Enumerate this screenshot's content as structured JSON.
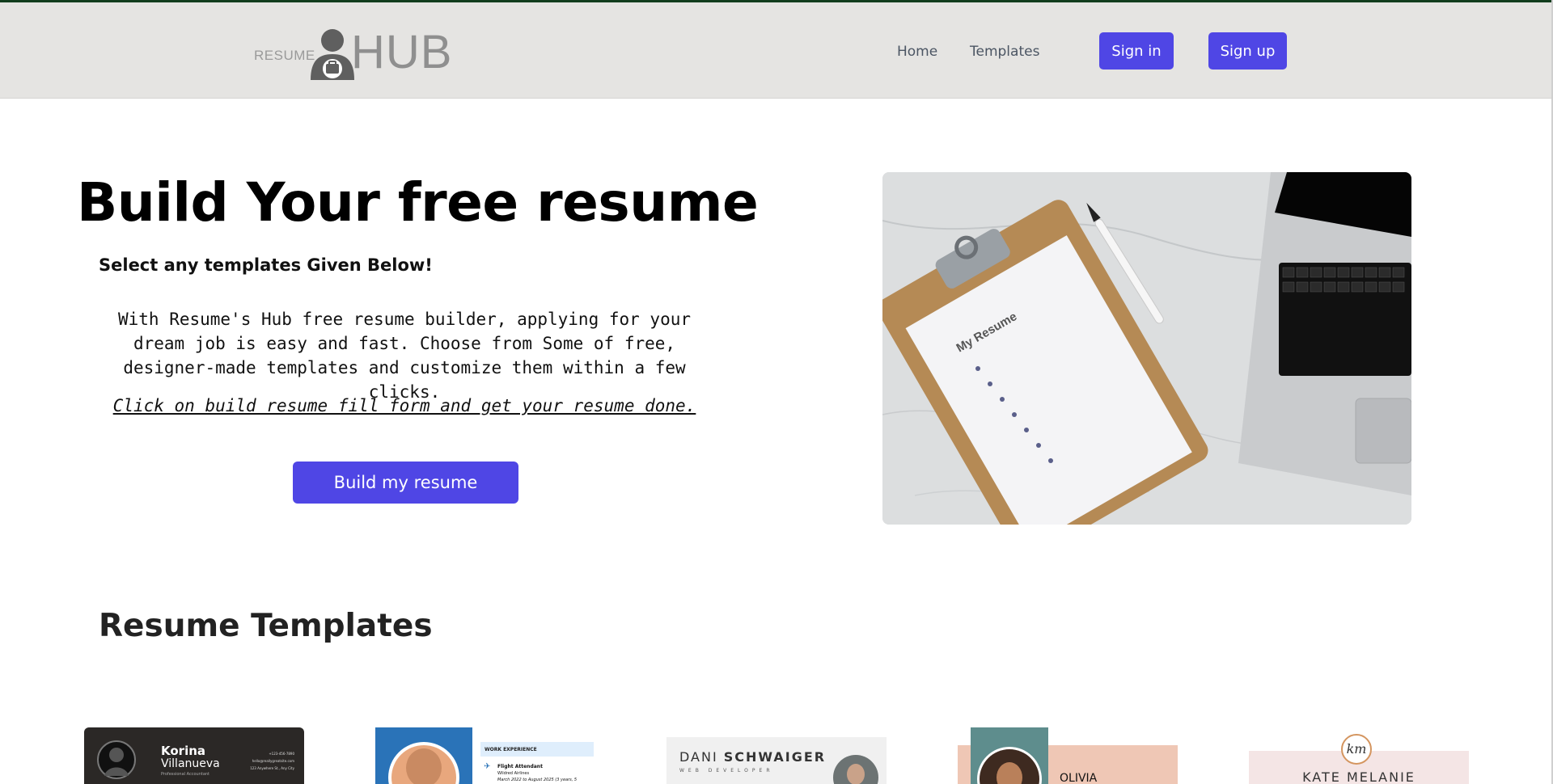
{
  "header": {
    "logo": {
      "small": "RESUME",
      "big": "HUB"
    },
    "nav": [
      "Home",
      "Templates"
    ],
    "sign_in": "Sign in",
    "sign_up": "Sign up"
  },
  "hero": {
    "title": "Build Your free resume",
    "subtitle": "Select any templates Given Below!",
    "text": "With Resume's Hub free resume builder, applying for your dream job is easy and fast. Choose from Some of free, designer-made templates and customize them within a few clicks.",
    "note": "Click on build resume fill form and get your resume done.",
    "button": "Build my resume",
    "image_caption": "My Resume"
  },
  "templates": {
    "title": "Resume Templates",
    "items": [
      {
        "first": "Korina",
        "last": "Villanueva",
        "role": "Professional Accountant",
        "contact": [
          "+123-456-7890",
          "hello@reallygreatsite.com",
          "123 Anywhere St., Any City"
        ],
        "bg": "#2b2826"
      },
      {
        "section": "WORK EXPERIENCE",
        "job": "Flight Attendant",
        "company": "Wildred Airlines",
        "dates": "March 2022 to August 2025 (3 years, 5",
        "bg": "#2a73b8"
      },
      {
        "first": "DANI",
        "last": "SCHWAIGER",
        "role": "WEB DEVELOPER",
        "bg": "#f0f0f0"
      },
      {
        "name": "OLIVIA",
        "bg": "#efc7b5",
        "accent": "#5e8d8d"
      },
      {
        "monogram": "km",
        "name": "KATE MELANIE",
        "bg": "#f4e5e5"
      }
    ]
  },
  "colors": {
    "accent": "#4f46e5",
    "header_bg": "#e5e4e2",
    "header_top_border": "#123d1d"
  }
}
